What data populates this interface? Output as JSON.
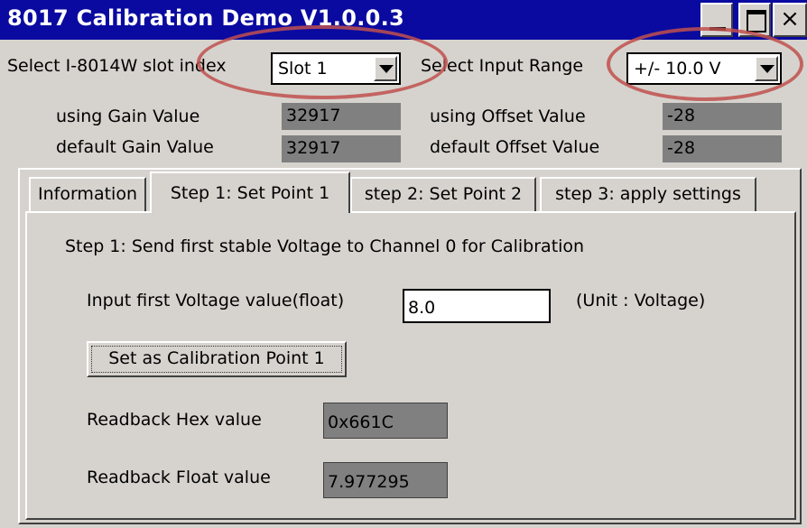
{
  "window": {
    "title": "8017 Calibration Demo V1.0.0.3",
    "close_glyph": "×"
  },
  "slot": {
    "label": "Select I-8014W slot index",
    "value": "Slot 1"
  },
  "range": {
    "label": "Select Input Range",
    "value": "+/- 10.0 V"
  },
  "gain": {
    "using_label": "using Gain Value",
    "using_value": "32917",
    "default_label": "default Gain Value",
    "default_value": "32917"
  },
  "offset": {
    "using_label": "using Offset Value",
    "using_value": "-28",
    "default_label": "default Offset Value",
    "default_value": "-28"
  },
  "tabs": [
    {
      "label": "Information"
    },
    {
      "label": "Step 1: Set Point 1"
    },
    {
      "label": "step 2: Set Point 2"
    },
    {
      "label": "step 3: apply settings"
    }
  ],
  "active_tab": "Step 1: Set Point 1",
  "step1": {
    "instruction": "Step 1: Send first stable Voltage to Channel 0 for Calibration",
    "input_label": "Input first Voltage value(float)",
    "input_value": "8.0",
    "unit_label": "(Unit : Voltage)",
    "set_button": "Set as Calibration Point 1",
    "hex_label": "Readback Hex value",
    "hex_value": "0x661C",
    "float_label": "Readback Float value",
    "float_value": "7.977295"
  },
  "colors": {
    "titlebar": "#0a0aa0",
    "face": "#d6d3ce",
    "readonly": "#808080",
    "annotation": "#c0504d"
  }
}
